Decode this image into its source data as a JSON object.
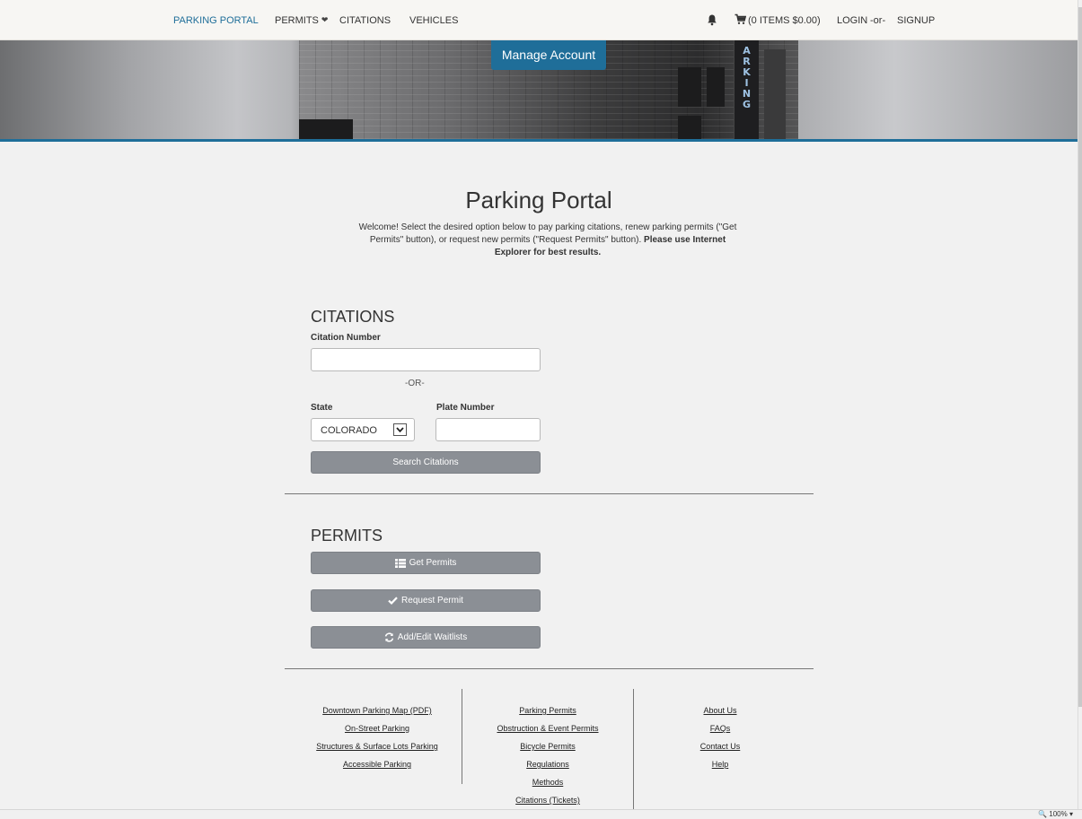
{
  "nav": {
    "brand": "PARKING PORTAL",
    "permits": "PERMITS",
    "citations": "CITATIONS",
    "vehicles": "VEHICLES",
    "cart": "(0 ITEMS $0.00)",
    "login": "LOGIN",
    "or": "-or-",
    "signup": "SIGNUP",
    "accent": "#1f6e99"
  },
  "banner": {
    "manage_account": "Manage Account",
    "sign_letters": [
      "A",
      "R",
      "K",
      "I",
      "N",
      "G"
    ]
  },
  "main": {
    "title": "Parking Portal",
    "welcome": "Welcome! Select the desired option below to pay parking citations, renew parking permits (\"Get Permits\" button), or request new permits (\"Request Permits\" button).",
    "welcome_bold": "Please use Internet Explorer for best results."
  },
  "citations": {
    "title": "CITATIONS",
    "citation_number_label": "Citation Number",
    "citation_number_value": "",
    "or": "-OR-",
    "state_label": "State",
    "state_value": "COLORADO",
    "plate_label": "Plate Number",
    "plate_value": "",
    "search_button": "Search Citations"
  },
  "permits": {
    "title": "PERMITS",
    "get_permits": "Get Permits",
    "request_permit": "Request Permit",
    "waitlists": "Add/Edit Waitlists"
  },
  "footer": {
    "col1": [
      "Downtown Parking Map (PDF)",
      "On-Street Parking",
      "Structures & Surface Lots Parking",
      "Accessible Parking"
    ],
    "col2": [
      "Parking Permits",
      "Obstruction & Event Permits",
      "Bicycle Permits",
      "Regulations",
      "Methods",
      "Citations (Tickets)"
    ],
    "col3": [
      "About Us",
      "FAQs",
      "Contact Us",
      "Help"
    ]
  },
  "status": {
    "zoom": "100%"
  }
}
